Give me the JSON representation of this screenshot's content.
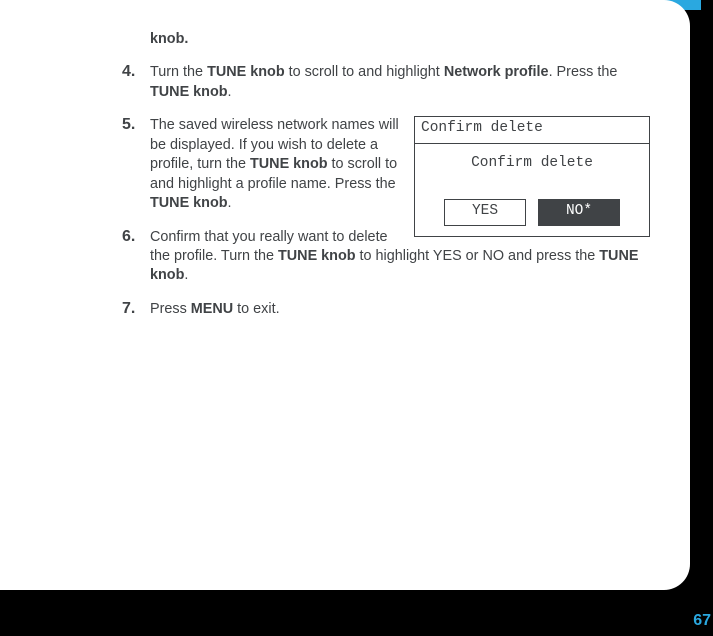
{
  "intro_fragment_bold": "knob",
  "intro_fragment_after": ".",
  "steps": {
    "s4": {
      "pre": "Turn the ",
      "b1": "TUNE knob",
      "mid": " to scroll to and highlight ",
      "b2": "Network profile",
      "after1": ". Press the ",
      "b3": "TUNE knob",
      "after2": "."
    },
    "s5": {
      "pre": "The saved wireless network names will be displayed. If you wish to delete a profile, turn the ",
      "b1": "TUNE knob",
      "mid": " to scroll to and highlight a profile name. Press the ",
      "b2": "TUNE knob",
      "after": "."
    },
    "s6": {
      "pre": "Confirm that you really want to delete the profile. Turn the ",
      "b1": "TUNE knob",
      "mid": " to highlight YES or NO and press the ",
      "b2": "TUNE knob",
      "after": "."
    },
    "s7": {
      "pre": "Press ",
      "b1": "MENU",
      "after": " to exit."
    }
  },
  "dialog": {
    "title": "Confirm delete",
    "body": "Confirm delete",
    "yes": "YES",
    "no": "NO*"
  },
  "page_number": "67"
}
